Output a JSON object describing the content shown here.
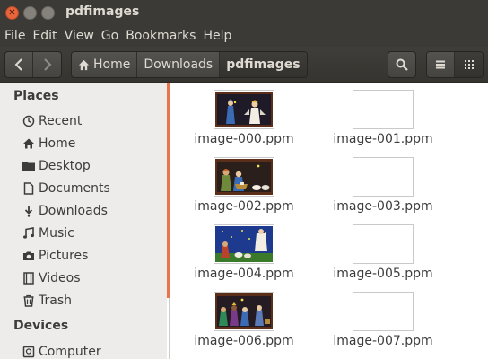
{
  "window": {
    "title": "pdfimages"
  },
  "menu": [
    "File",
    "Edit",
    "View",
    "Go",
    "Bookmarks",
    "Help"
  ],
  "breadcrumbs": [
    {
      "label": "Home",
      "icon": "home-icon"
    },
    {
      "label": "Downloads"
    },
    {
      "label": "pdfimages",
      "active": true
    }
  ],
  "sidebar": {
    "places_heading": "Places",
    "places": [
      {
        "label": "Recent",
        "icon": "clock-icon"
      },
      {
        "label": "Home",
        "icon": "home-icon"
      },
      {
        "label": "Desktop",
        "icon": "folder-icon"
      },
      {
        "label": "Documents",
        "icon": "document-icon"
      },
      {
        "label": "Downloads",
        "icon": "download-icon"
      },
      {
        "label": "Music",
        "icon": "music-icon"
      },
      {
        "label": "Pictures",
        "icon": "camera-icon"
      },
      {
        "label": "Videos",
        "icon": "film-icon"
      },
      {
        "label": "Trash",
        "icon": "trash-icon"
      }
    ],
    "devices_heading": "Devices",
    "devices": [
      {
        "label": "Computer",
        "icon": "computer-icon"
      }
    ]
  },
  "files": [
    {
      "name": "image-000.ppm",
      "thumb": "nativity-angel"
    },
    {
      "name": "image-001.ppm",
      "thumb": "blank"
    },
    {
      "name": "image-002.ppm",
      "thumb": "nativity-manger"
    },
    {
      "name": "image-003.ppm",
      "thumb": "blank"
    },
    {
      "name": "image-004.ppm",
      "thumb": "night-angel"
    },
    {
      "name": "image-005.ppm",
      "thumb": "blank"
    },
    {
      "name": "image-006.ppm",
      "thumb": "nativity-kings"
    },
    {
      "name": "image-007.ppm",
      "thumb": "blank"
    }
  ],
  "colors": {
    "titlebar": "#3b3a37",
    "accent_orange": "#e8764a",
    "sidebar_bg": "#edecea"
  }
}
